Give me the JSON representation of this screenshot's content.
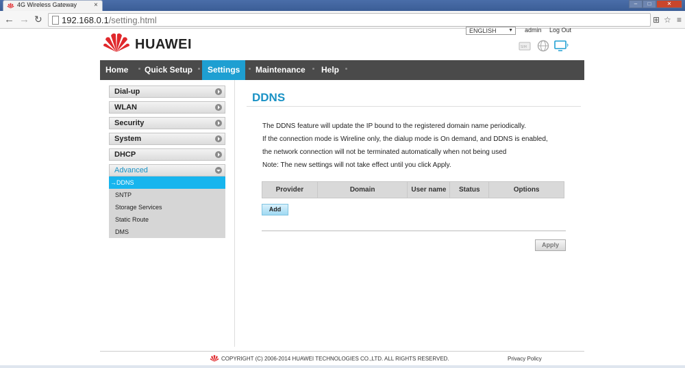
{
  "browser": {
    "tab_title": "4G Wireless Gateway",
    "tab_close": "×",
    "url_host": "192.168.0.1",
    "url_path": "/setting.html"
  },
  "header": {
    "brand": "HUAWEI",
    "language": "ENGLISH",
    "user": "admin",
    "logout": "Log Out",
    "status_icons": [
      "sim-icon",
      "globe-icon",
      "monitor-icon"
    ]
  },
  "nav": {
    "items": [
      "Home",
      "Quick Setup",
      "Settings",
      "Maintenance",
      "Help"
    ],
    "active": "Settings"
  },
  "sidebar": {
    "items": [
      "Dial-up",
      "WLAN",
      "Security",
      "System",
      "DHCP",
      "Advanced"
    ],
    "sub_items": [
      "→DDNS",
      "SNTP",
      "Storage Services",
      "Static Route",
      "DMS"
    ]
  },
  "content": {
    "title": "DDNS",
    "description": [
      "The DDNS feature will update the IP bound to the registered domain name periodically.",
      "If the connection mode is Wireline only, the dialup mode is On demand, and DDNS is enabled,",
      "the network connection will not be terminated automatically when not being used",
      "Note: The new settings will not take effect until you click Apply."
    ],
    "table_headers": [
      "Provider",
      "Domain",
      "User name",
      "Status",
      "Options"
    ],
    "add_label": "Add",
    "apply_label": "Apply"
  },
  "footer": {
    "copyright": "COPYRIGHT (C) 2006-2014 HUAWEI TECHNOLOGIES CO.,LTD. ALL RIGHTS RESERVED.",
    "privacy": "Privacy Policy"
  },
  "colors": {
    "accent": "#1e9fd2",
    "nav_bg": "#4a4a4a",
    "brand_red": "#e0282c"
  }
}
